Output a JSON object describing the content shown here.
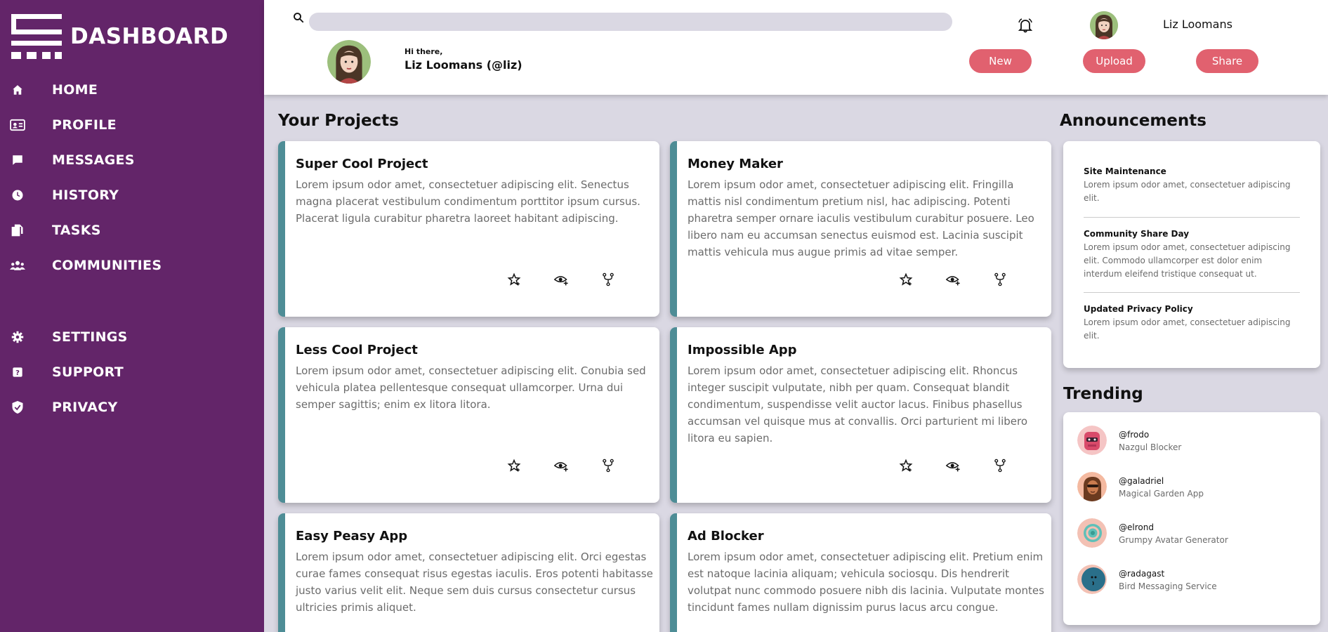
{
  "sidebar": {
    "brand": "DASHBOARD",
    "items": [
      {
        "label": "HOME",
        "icon": "home-icon"
      },
      {
        "label": "PROFILE",
        "icon": "id-card-icon"
      },
      {
        "label": "MESSAGES",
        "icon": "chat-bubble-icon"
      },
      {
        "label": "HISTORY",
        "icon": "clock-icon"
      },
      {
        "label": "TASKS",
        "icon": "documents-icon"
      },
      {
        "label": "COMMUNITIES",
        "icon": "people-icon"
      },
      {
        "label": "SETTINGS",
        "icon": "gear-icon"
      },
      {
        "label": "SUPPORT",
        "icon": "help-icon"
      },
      {
        "label": "PRIVACY",
        "icon": "shield-icon"
      }
    ]
  },
  "header": {
    "search_placeholder": "",
    "username": "Liz Loomans",
    "greeting_small": "Hi there,",
    "greeting_name": "Liz Loomans (@liz)",
    "buttons": {
      "new": "New",
      "upload": "Upload",
      "share": "Share"
    }
  },
  "projects": {
    "title": "Your Projects",
    "items": [
      {
        "name": "Super Cool Project",
        "desc": "Lorem ipsum odor amet, consectetuer adipiscing elit. Senectus magna placerat vestibulum condimentum porttitor ipsum cursus. Placerat ligula curabitur pharetra laoreet habitant adipiscing."
      },
      {
        "name": "Money Maker",
        "desc": "Lorem ipsum odor amet, consectetuer adipiscing elit. Fringilla mattis nisl condimentum pretium nisl, hac adipiscing. Potenti pharetra semper ornare iaculis vestibulum curabitur posuere. Leo libero nam eu accumsan senectus euismod est. Lacinia suscipit mattis vehicula mus augue primis ad vitae semper."
      },
      {
        "name": "Less Cool Project",
        "desc": "Lorem ipsum odor amet, consectetuer adipiscing elit. Conubia sed vehicula platea pellentesque consequat ullamcorper. Urna dui semper sagittis; enim ex litora litora."
      },
      {
        "name": "Impossible App",
        "desc": "Lorem ipsum odor amet, consectetuer adipiscing elit. Rhoncus integer suscipit vulputate, nibh per quam. Consequat blandit condimentum, suspendisse velit auctor lacus. Finibus phasellus accumsan vel quisque mus at convallis. Orci parturient mi libero litora eu sapien."
      },
      {
        "name": "Easy Peasy App",
        "desc": "Lorem ipsum odor amet, consectetuer adipiscing elit. Orci egestas curae fames consequat risus egestas iaculis. Eros potenti habitasse justo varius velit elit. Neque sem duis cursus consectetur cursus ultricies primis aliquet."
      },
      {
        "name": "Ad Blocker",
        "desc": "Lorem ipsum odor amet, consectetuer adipiscing elit. Pretium enim est natoque lacinia aliquam; vehicula sociosqu. Dis hendrerit volutpat nunc commodo posuere nibh dis lacinia. Vulputate montes tincidunt fames nullam dignissim purus lacus arcu congue."
      }
    ]
  },
  "announcements": {
    "title": "Announcements",
    "items": [
      {
        "title": "Site Maintenance",
        "body": "Lorem ipsum odor amet, consectetuer adipiscing elit."
      },
      {
        "title": "Community Share Day",
        "body": "Lorem ipsum odor amet, consectetuer adipiscing elit. Commodo ullamcorper est dolor enim interdum eleifend tristique consequat ut."
      },
      {
        "title": "Updated Privacy Policy",
        "body": "Lorem ipsum odor amet, consectetuer adipiscing elit."
      }
    ]
  },
  "trending": {
    "title": "Trending",
    "items": [
      {
        "user": "@frodo",
        "project": "Nazgul Blocker"
      },
      {
        "user": "@galadriel",
        "project": "Magical Garden App"
      },
      {
        "user": "@elrond",
        "project": "Grumpy Avatar Generator"
      },
      {
        "user": "@radagast",
        "project": "Bird Messaging Service"
      }
    ]
  },
  "colors": {
    "sidebar_bg": "#632569",
    "page_bg": "#dad8e3",
    "accent_button": "#e1616f",
    "card_accent": "#4e8d96"
  }
}
